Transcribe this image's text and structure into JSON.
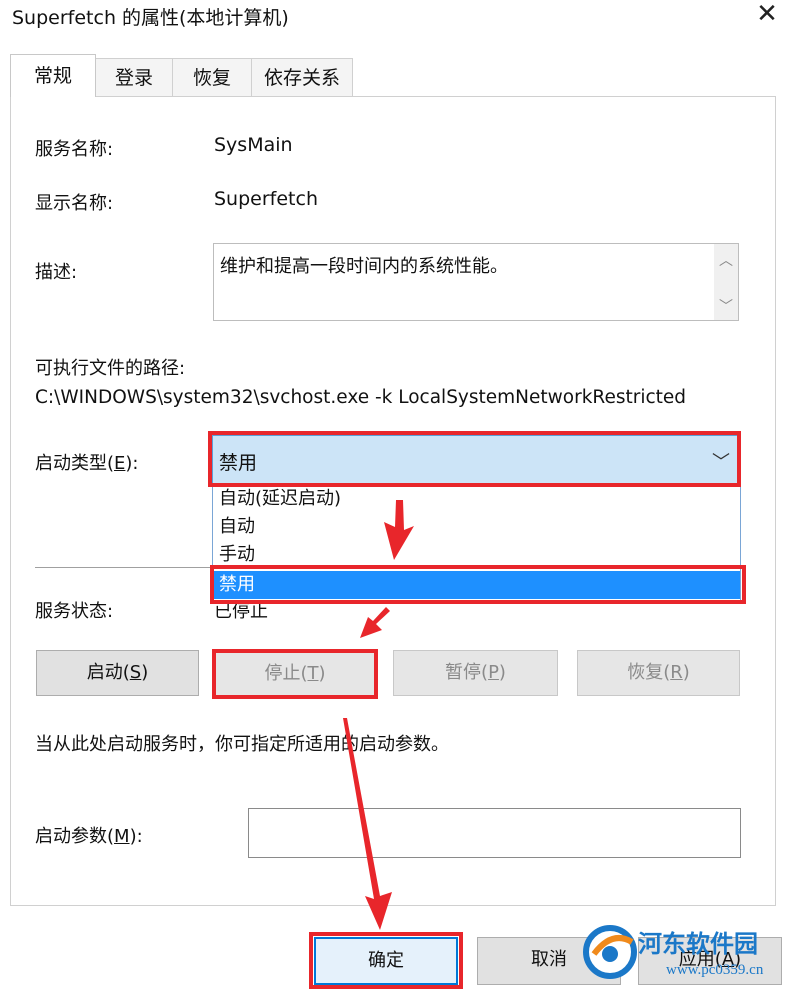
{
  "window": {
    "title": "Superfetch 的属性(本地计算机)",
    "close_glyph": "✕"
  },
  "tabs": [
    {
      "label": "常规",
      "active": true
    },
    {
      "label": "登录",
      "active": false
    },
    {
      "label": "恢复",
      "active": false
    },
    {
      "label": "依存关系",
      "active": false
    }
  ],
  "general": {
    "service_name_label": "服务名称:",
    "service_name_value": "SysMain",
    "display_name_label": "显示名称:",
    "display_name_value": "Superfetch",
    "description_label": "描述:",
    "description_value": "维护和提高一段时间内的系统性能。",
    "exe_path_label": "可执行文件的路径:",
    "exe_path_value": "C:\\WINDOWS\\system32\\svchost.exe -k LocalSystemNetworkRestricted",
    "startup_type_label_pre": "启动类型(",
    "startup_type_label_key": "E",
    "startup_type_label_post": "):",
    "startup_type_value": "禁用",
    "startup_options": [
      "自动(延迟启动)",
      "自动",
      "手动",
      "禁用"
    ],
    "startup_selected_index": 3,
    "service_status_label": "服务状态:",
    "service_status_value": "已停止",
    "hint_text": "当从此处启动服务时，你可指定所适用的启动参数。",
    "start_params_label_pre": "启动参数(",
    "start_params_label_key": "M",
    "start_params_label_post": "):",
    "start_params_value": ""
  },
  "service_buttons": {
    "start": {
      "pre": "启动(",
      "key": "S",
      "post": ")",
      "enabled": true
    },
    "stop": {
      "pre": "停止(",
      "key": "T",
      "post": ")",
      "enabled": false
    },
    "pause": {
      "pre": "暂停(",
      "key": "P",
      "post": ")",
      "enabled": false
    },
    "resume": {
      "pre": "恢复(",
      "key": "R",
      "post": ")",
      "enabled": false
    }
  },
  "dialog_buttons": {
    "ok": "确定",
    "cancel": "取消",
    "apply_pre": "应用(",
    "apply_key": "A",
    "apply_post": ")"
  },
  "watermark": {
    "text": "河东软件园",
    "url": "www.pc0359.cn"
  },
  "colors": {
    "annotation_red": "#e8262b",
    "select_bg": "#cce4f7",
    "selected_item": "#1e90ff",
    "watermark_blue": "#1b78c8"
  }
}
